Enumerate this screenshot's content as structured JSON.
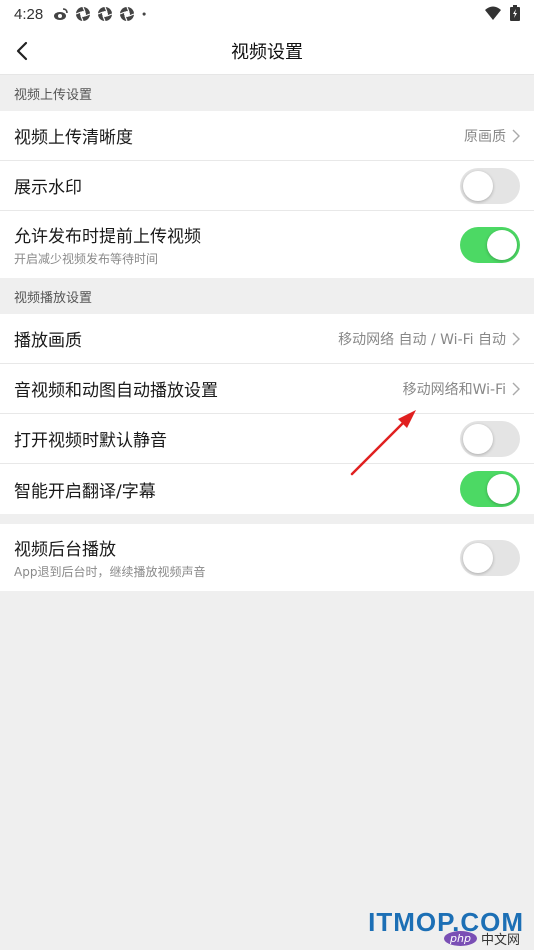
{
  "status_bar": {
    "time": "4:28",
    "icons": [
      "weibo-icon",
      "aperture-icon",
      "aperture-icon",
      "aperture-icon",
      "dot-icon"
    ],
    "right_icons": [
      "wifi-icon",
      "battery-icon"
    ]
  },
  "nav": {
    "title": "视频设置"
  },
  "sections": {
    "upload": {
      "header": "视频上传设置",
      "resolution_label": "视频上传清晰度",
      "resolution_value": "原画质",
      "watermark_label": "展示水印",
      "preupload_label": "允许发布时提前上传视频",
      "preupload_sub": "开启减少视频发布等待时间"
    },
    "playback": {
      "header": "视频播放设置",
      "quality_label": "播放画质",
      "quality_value": "移动网络 自动 / Wi-Fi 自动",
      "autoplay_label": "音视频和动图自动播放设置",
      "autoplay_value": "移动网络和Wi-Fi",
      "mute_label": "打开视频时默认静音",
      "subtitle_label": "智能开启翻译/字幕"
    },
    "background": {
      "label": "视频后台播放",
      "sub": "App退到后台时，继续播放视频声音"
    }
  },
  "toggles": {
    "watermark": false,
    "preupload": true,
    "mute": false,
    "subtitle": true,
    "background": false
  },
  "colors": {
    "toggle_on": "#4cd964",
    "toggle_off": "#e4e4e4",
    "annotation_arrow": "#e02020"
  },
  "watermark": {
    "brand": "ITMOP.COM",
    "php_badge": "php",
    "cn_site": "中文网"
  }
}
